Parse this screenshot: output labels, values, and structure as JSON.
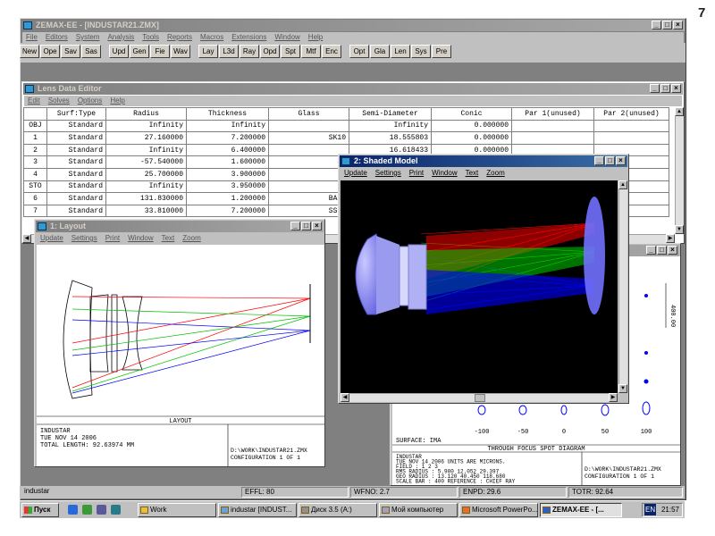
{
  "page_number": "7",
  "main_window": {
    "title": "ZEMAX-EE - [INDUSTAR21.ZMX]",
    "menu": [
      "File",
      "Editors",
      "System",
      "Analysis",
      "Tools",
      "Reports",
      "Macros",
      "Extensions",
      "Window",
      "Help"
    ],
    "toolbar": [
      "New",
      "Ope",
      "Sav",
      "Sas",
      "Upd",
      "Gen",
      "Fie",
      "Wav",
      "Lay",
      "L3d",
      "Ray",
      "Opd",
      "Spt",
      "Mtf",
      "Enc",
      "Opt",
      "Gla",
      "Len",
      "Sys",
      "Pre"
    ]
  },
  "lens_editor": {
    "title": "Lens Data Editor",
    "menu": [
      "Edit",
      "Solves",
      "Options",
      "Help"
    ],
    "columns": [
      "Surf:Type",
      "Radius",
      "Thickness",
      "Glass",
      "Semi-Diameter",
      "Conic",
      "Par 1(unused)",
      "Par 2(unused)"
    ],
    "rows": [
      [
        "OBJ",
        "Standard",
        "Infinity",
        "Infinity",
        "",
        "Infinity",
        "0.000000",
        "",
        ""
      ],
      [
        "1",
        "Standard",
        "27.160000",
        "7.200000",
        "SK10",
        "18.555803",
        "0.000000",
        "",
        ""
      ],
      [
        "2",
        "Standard",
        "Infinity",
        "6.400000",
        "",
        "16.618433",
        "0.000000",
        "",
        ""
      ],
      [
        "3",
        "Standard",
        "-57.540000",
        "1.600000",
        "SF",
        "",
        "",
        "",
        ""
      ],
      [
        "4",
        "Standard",
        "25.700000",
        "3.900000",
        "",
        "",
        "",
        "",
        ""
      ],
      [
        "STO",
        "Standard",
        "Infinity",
        "3.950000",
        "",
        "",
        "",
        "",
        ""
      ],
      [
        "6",
        "Standard",
        "131.830000",
        "1.200000",
        "BAFL",
        "",
        "",
        "",
        ""
      ],
      [
        "7",
        "Standard",
        "33.810000",
        "7.200000",
        "SSKN",
        "",
        "",
        "",
        ""
      ]
    ]
  },
  "layout_window": {
    "title": "1: Layout",
    "menu": [
      "Update",
      "Settings",
      "Print",
      "Window",
      "Text",
      "Zoom"
    ],
    "footer_title": "LAYOUT",
    "info_lines": [
      "INDUSTAR",
      "TUE NOV 14 2006",
      "TOTAL LENGTH:    92.63974 MM"
    ],
    "file_lines": [
      "D:\\WORK\\INDUSTAR21.ZMX",
      "CONFIGURATION 1 OF 1"
    ]
  },
  "shaded_window": {
    "title": "2: Shaded Model",
    "menu": [
      "Update",
      "Settings",
      "Print",
      "Window",
      "Text",
      "Zoom"
    ]
  },
  "spot_window": {
    "scale_label": "400.00",
    "axis_ticks": [
      "-100",
      "-50",
      "0",
      "50",
      "100"
    ],
    "surface": "SURFACE: IMA",
    "footer_title": "THROUGH FOCUS SPOT DIAGRAM",
    "info_lines": [
      "INDUSTAR",
      "TUE NOV 14 2006   UNITS ARE MICRONS.",
      "FIELD     :    1       2       3",
      "RMS RADIUS :  5.980  12.052  29.397",
      "GEO RADIUS :  13.120  40.450 118.680",
      "SCALE BAR  :   400     REFERENCE : CHIEF RAY"
    ],
    "file_lines": [
      "D:\\WORK\\INDUSTAR21.ZMX",
      "CONFIGURATION 1 OF 1"
    ]
  },
  "status_bar": {
    "left": "industar",
    "effl": "EFFL: 80",
    "wfno": "WFNO: 2.7",
    "enpd": "ENPD: 29.6",
    "totr": "TOTR: 92.64"
  },
  "taskbar": {
    "start": "Пуск",
    "tasks": [
      "Work",
      "industar [INDUST...",
      "Диск 3.5 (A:)",
      "Мой компьютер",
      "Microsoft PowerPo...",
      "ZEMAX-EE - [..."
    ],
    "lang": "EN",
    "clock": "21:57"
  },
  "colors": {
    "title_active": "#0a246a",
    "ray_red": "#ff0000",
    "ray_green": "#00d000",
    "ray_blue": "#0000ff",
    "lens_shade": "#8080ff"
  }
}
